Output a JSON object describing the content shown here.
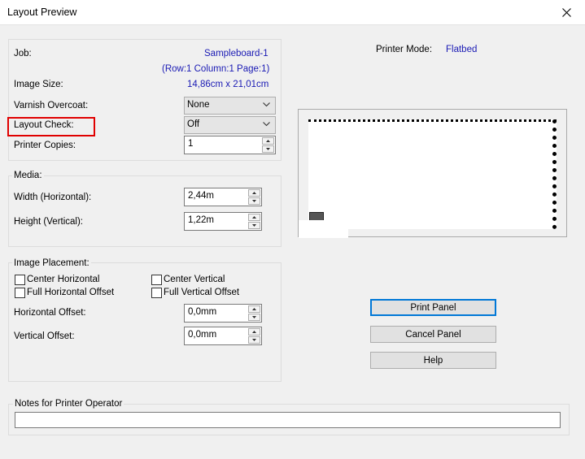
{
  "window": {
    "title": "Layout Preview"
  },
  "job": {
    "job_label": "Job:",
    "job_value": "Sampleboard-1",
    "position_value": "(Row:1 Column:1 Page:1)",
    "image_size_label": "Image Size:",
    "image_size_value": "14,86cm x 21,01cm",
    "varnish_label": "Varnish Overcoat:",
    "varnish_value": "None",
    "layout_check_label": "Layout Check:",
    "layout_check_value": "Off",
    "copies_label": "Printer Copies:",
    "copies_value": "1"
  },
  "media": {
    "group_label": "Media:",
    "width_label": "Width (Horizontal):",
    "width_value": "2,44m",
    "height_label": "Height (Vertical):",
    "height_value": "1,22m"
  },
  "placement": {
    "group_label": "Image Placement:",
    "center_h_label": "Center Horizontal",
    "center_v_label": "Center Vertical",
    "full_h_label": "Full Horizontal Offset",
    "full_v_label": "Full Vertical Offset",
    "h_offset_label": "Horizontal Offset:",
    "h_offset_value": "0,0mm",
    "v_offset_label": "Vertical Offset:",
    "v_offset_value": "0,0mm"
  },
  "printer": {
    "mode_label": "Printer Mode:",
    "mode_value": "Flatbed"
  },
  "buttons": {
    "print_panel": "Print Panel",
    "cancel_panel": "Cancel Panel",
    "help": "Help"
  },
  "notes": {
    "group_label": "Notes for Printer Operator",
    "value": ""
  },
  "colors": {
    "accent": "#0078d7",
    "value_text": "#1a1ab4",
    "highlight_box": "#e00000"
  }
}
